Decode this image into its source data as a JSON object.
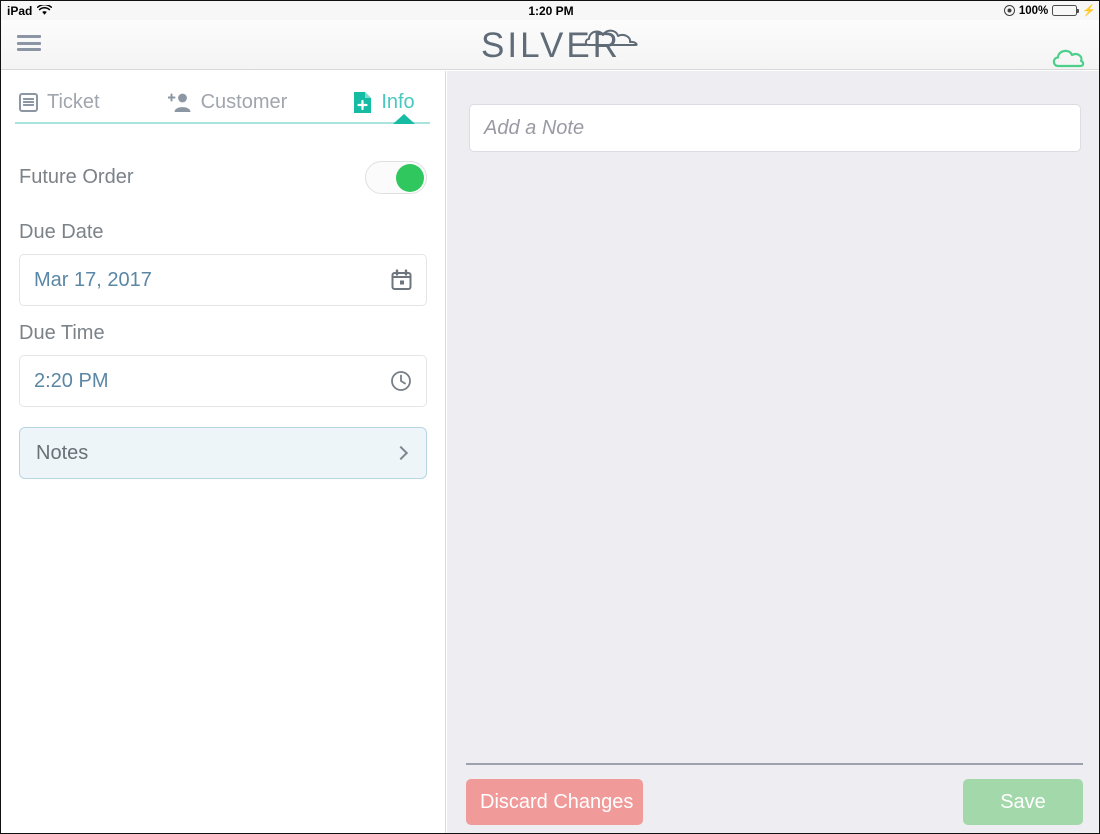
{
  "status_bar": {
    "device": "iPad",
    "wifi_icon": "wifi-icon",
    "time": "1:20 PM",
    "location_icon": "location-services-icon",
    "battery_percent": "100%",
    "battery_icon": "battery-full-icon",
    "charging_icon": "lightning-bolt-icon"
  },
  "header": {
    "menu_icon": "hamburger-menu-icon",
    "logo_text": "SILVER",
    "logo_cloud_icon": "cloud-icon",
    "sync_cloud_icon": "cloud-sync-icon"
  },
  "tabs": [
    {
      "label": "Ticket",
      "icon": "ticket-list-icon",
      "active": false
    },
    {
      "label": "Customer",
      "icon": "add-person-icon",
      "active": false
    },
    {
      "label": "Info",
      "icon": "document-add-icon",
      "active": true
    }
  ],
  "left_panel": {
    "future_order": {
      "label": "Future Order",
      "toggle_state": "on"
    },
    "due_date": {
      "label": "Due Date",
      "value": "Mar 17, 2017",
      "icon": "calendar-icon"
    },
    "due_time": {
      "label": "Due Time",
      "value": "2:20 PM",
      "icon": "clock-icon"
    },
    "notes_row": {
      "label": "Notes",
      "chevron_icon": "chevron-right-icon",
      "selected": true
    }
  },
  "right_panel": {
    "note_placeholder": "Add a Note",
    "note_value": "",
    "discard_label": "Discard Changes",
    "save_label": "Save"
  },
  "colors": {
    "accent_teal": "#16bba4",
    "toggle_green": "#30c85e",
    "value_blue": "#5a87a5",
    "discard_red": "#f09a9a",
    "save_green": "#a3d8ab",
    "panel_bg": "#eeedf2"
  }
}
